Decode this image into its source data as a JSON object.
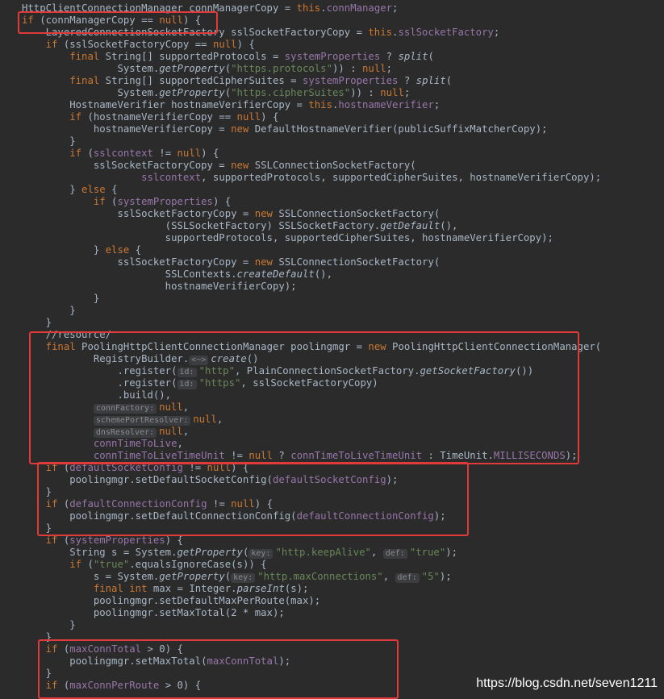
{
  "code_lines": [
    [
      [
        "HttpClientConnectionManager connManagerCopy = ",
        "p"
      ],
      [
        "this",
        "kw"
      ],
      [
        ".",
        "p"
      ],
      [
        "connManager",
        "fld"
      ],
      [
        ";",
        "p"
      ]
    ],
    [
      [
        "if",
        "kw"
      ],
      [
        " (",
        "p"
      ],
      [
        "connManagerCopy",
        "p"
      ],
      [
        " == ",
        "p"
      ],
      [
        "null",
        "kw"
      ],
      [
        ") {",
        "p"
      ]
    ],
    [
      [
        "    LayeredConnectionSocketFactory sslSocketFactoryCopy = ",
        "p"
      ],
      [
        "this",
        "kw"
      ],
      [
        ".",
        "p"
      ],
      [
        "sslSocketFactory",
        "fld"
      ],
      [
        ";",
        "p"
      ]
    ],
    [
      [
        "    ",
        "p"
      ],
      [
        "if",
        "kw"
      ],
      [
        " (sslSocketFactoryCopy == ",
        "p"
      ],
      [
        "null",
        "kw"
      ],
      [
        ") {",
        "p"
      ]
    ],
    [
      [
        "        ",
        "p"
      ],
      [
        "final",
        "kw"
      ],
      [
        " String[] supportedProtocols = ",
        "p"
      ],
      [
        "systemProperties",
        "fld"
      ],
      [
        " ? ",
        "p"
      ],
      [
        "split",
        "ital"
      ],
      [
        "(",
        "p"
      ]
    ],
    [
      [
        "                System.",
        "p"
      ],
      [
        "getProperty",
        "ital"
      ],
      [
        "(",
        "p"
      ],
      [
        "\"https.protocols\"",
        "str"
      ],
      [
        ")) : ",
        "p"
      ],
      [
        "null",
        "kw"
      ],
      [
        ";",
        "p"
      ]
    ],
    [
      [
        "        ",
        "p"
      ],
      [
        "final",
        "kw"
      ],
      [
        " String[] supportedCipherSuites = ",
        "p"
      ],
      [
        "systemProperties",
        "fld"
      ],
      [
        " ? ",
        "p"
      ],
      [
        "split",
        "ital"
      ],
      [
        "(",
        "p"
      ]
    ],
    [
      [
        "                System.",
        "p"
      ],
      [
        "getProperty",
        "ital"
      ],
      [
        "(",
        "p"
      ],
      [
        "\"https.cipherSuites\"",
        "str"
      ],
      [
        ")) : ",
        "p"
      ],
      [
        "null",
        "kw"
      ],
      [
        ";",
        "p"
      ]
    ],
    [
      [
        "        HostnameVerifier hostnameVerifierCopy = ",
        "p"
      ],
      [
        "this",
        "kw"
      ],
      [
        ".",
        "p"
      ],
      [
        "hostnameVerifier",
        "fld"
      ],
      [
        ";",
        "p"
      ]
    ],
    [
      [
        "        ",
        "p"
      ],
      [
        "if",
        "kw"
      ],
      [
        " (hostnameVerifierCopy == ",
        "p"
      ],
      [
        "null",
        "kw"
      ],
      [
        ") {",
        "p"
      ]
    ],
    [
      [
        "            hostnameVerifierCopy = ",
        "p"
      ],
      [
        "new",
        "kw"
      ],
      [
        " DefaultHostnameVerifier(publicSuffixMatcherCopy);",
        "p"
      ]
    ],
    [
      [
        "        }",
        "p"
      ]
    ],
    [
      [
        "        ",
        "p"
      ],
      [
        "if",
        "kw"
      ],
      [
        " (",
        "p"
      ],
      [
        "sslcontext",
        "fld"
      ],
      [
        " != ",
        "p"
      ],
      [
        "null",
        "kw"
      ],
      [
        ") {",
        "p"
      ]
    ],
    [
      [
        "            sslSocketFactoryCopy = ",
        "p"
      ],
      [
        "new",
        "kw"
      ],
      [
        " SSLConnectionSocketFactory(",
        "p"
      ]
    ],
    [
      [
        "                    ",
        "p"
      ],
      [
        "sslcontext",
        "fld"
      ],
      [
        ", supportedProtocols, supportedCipherSuites, hostnameVerifierCopy);",
        "p"
      ]
    ],
    [
      [
        "        } ",
        "p"
      ],
      [
        "else",
        "kw"
      ],
      [
        " {",
        "p"
      ]
    ],
    [
      [
        "            ",
        "p"
      ],
      [
        "if",
        "kw"
      ],
      [
        " (",
        "p"
      ],
      [
        "systemProperties",
        "fld"
      ],
      [
        ") {",
        "p"
      ]
    ],
    [
      [
        "                sslSocketFactoryCopy = ",
        "p"
      ],
      [
        "new",
        "kw"
      ],
      [
        " SSLConnectionSocketFactory(",
        "p"
      ]
    ],
    [
      [
        "                        (SSLSocketFactory) SSLSocketFactory.",
        "p"
      ],
      [
        "getDefault",
        "ital"
      ],
      [
        "(),",
        "p"
      ]
    ],
    [
      [
        "                        supportedProtocols, supportedCipherSuites, hostnameVerifierCopy);",
        "p"
      ]
    ],
    [
      [
        "            } ",
        "p"
      ],
      [
        "else",
        "kw"
      ],
      [
        " {",
        "p"
      ]
    ],
    [
      [
        "                sslSocketFactoryCopy = ",
        "p"
      ],
      [
        "new",
        "kw"
      ],
      [
        " SSLConnectionSocketFactory(",
        "p"
      ]
    ],
    [
      [
        "                        SSLContexts.",
        "p"
      ],
      [
        "createDefault",
        "ital"
      ],
      [
        "(),",
        "p"
      ]
    ],
    [
      [
        "                        hostnameVerifierCopy);",
        "p"
      ]
    ],
    [
      [
        "            }",
        "p"
      ]
    ],
    [
      [
        "        }",
        "p"
      ]
    ],
    [
      [
        "    }",
        "p"
      ]
    ],
    [
      [
        "    //resource/",
        "p"
      ]
    ],
    [
      [
        "    ",
        "p"
      ],
      [
        "final",
        "kw"
      ],
      [
        " PoolingHttpClientConnectionManager poolingmgr = ",
        "p"
      ],
      [
        "new",
        "kw"
      ],
      [
        " PoolingHttpClientConnectionManager(",
        "p"
      ]
    ],
    [
      [
        "            RegistryBuilder.",
        "p"
      ],
      [
        "<~>",
        "hint"
      ],
      [
        "create",
        "ital"
      ],
      [
        "()",
        "p"
      ]
    ],
    [
      [
        "                .register(",
        "p"
      ],
      [
        "id:",
        "hint"
      ],
      [
        "\"http\"",
        "str"
      ],
      [
        ", PlainConnectionSocketFactory.",
        "p"
      ],
      [
        "getSocketFactory",
        "ital"
      ],
      [
        "())",
        "p"
      ]
    ],
    [
      [
        "                .register(",
        "p"
      ],
      [
        "id:",
        "hint"
      ],
      [
        "\"https\"",
        "str"
      ],
      [
        ", sslSocketFactoryCopy)",
        "p"
      ]
    ],
    [
      [
        "                .build(),",
        "p"
      ]
    ],
    [
      [
        "            ",
        "p"
      ],
      [
        "connFactory:",
        "hint"
      ],
      [
        "null",
        "kw"
      ],
      [
        ",",
        "p"
      ]
    ],
    [
      [
        "            ",
        "p"
      ],
      [
        "schemePortResolver:",
        "hint"
      ],
      [
        "null",
        "kw"
      ],
      [
        ",",
        "p"
      ]
    ],
    [
      [
        "            ",
        "p"
      ],
      [
        "dnsResolver:",
        "hint"
      ],
      [
        "null",
        "kw"
      ],
      [
        ",",
        "p"
      ]
    ],
    [
      [
        "            ",
        "p"
      ],
      [
        "connTimeToLive",
        "fld"
      ],
      [
        ",",
        "p"
      ]
    ],
    [
      [
        "            ",
        "p"
      ],
      [
        "connTimeToLiveTimeUnit",
        "fld"
      ],
      [
        " != ",
        "p"
      ],
      [
        "null",
        "kw"
      ],
      [
        " ? ",
        "p"
      ],
      [
        "connTimeToLiveTimeUnit",
        "fld"
      ],
      [
        " : TimeUnit.",
        "p"
      ],
      [
        "MILLISECONDS",
        "fld"
      ],
      [
        ");",
        "p"
      ]
    ],
    [
      [
        "    ",
        "p"
      ],
      [
        "if",
        "kw"
      ],
      [
        " (",
        "p"
      ],
      [
        "defaultSocketConfig",
        "fld"
      ],
      [
        " != ",
        "p"
      ],
      [
        "null",
        "kw"
      ],
      [
        ") {",
        "p"
      ]
    ],
    [
      [
        "        poolingmgr.setDefaultSocketConfig(",
        "p"
      ],
      [
        "defaultSocketConfig",
        "fld"
      ],
      [
        ");",
        "p"
      ]
    ],
    [
      [
        "    }",
        "p"
      ]
    ],
    [
      [
        "    ",
        "p"
      ],
      [
        "if",
        "kw"
      ],
      [
        " (",
        "p"
      ],
      [
        "defaultConnectionConfig",
        "fld"
      ],
      [
        " != ",
        "p"
      ],
      [
        "null",
        "kw"
      ],
      [
        ") {",
        "p"
      ]
    ],
    [
      [
        "        poolingmgr.setDefaultConnectionConfig(",
        "p"
      ],
      [
        "defaultConnectionConfig",
        "fld"
      ],
      [
        ");",
        "p"
      ]
    ],
    [
      [
        "    }",
        "p"
      ]
    ],
    [
      [
        "    ",
        "p"
      ],
      [
        "if",
        "kw"
      ],
      [
        " (",
        "p"
      ],
      [
        "systemProperties",
        "fld"
      ],
      [
        ") {",
        "p"
      ]
    ],
    [
      [
        "        String s = System.",
        "p"
      ],
      [
        "getProperty",
        "ital"
      ],
      [
        "(",
        "p"
      ],
      [
        "key:",
        "hint"
      ],
      [
        "\"http.keepAlive\"",
        "str"
      ],
      [
        ", ",
        "p"
      ],
      [
        "def:",
        "hint"
      ],
      [
        "\"true\"",
        "str"
      ],
      [
        ");",
        "p"
      ]
    ],
    [
      [
        "        ",
        "p"
      ],
      [
        "if",
        "kw"
      ],
      [
        " (",
        "p"
      ],
      [
        "\"true\"",
        "str"
      ],
      [
        ".equalsIgnoreCase(s)) {",
        "p"
      ]
    ],
    [
      [
        "            s = System.",
        "p"
      ],
      [
        "getProperty",
        "ital"
      ],
      [
        "(",
        "p"
      ],
      [
        "key:",
        "hint"
      ],
      [
        "\"http.maxConnections\"",
        "str"
      ],
      [
        ", ",
        "p"
      ],
      [
        "def:",
        "hint"
      ],
      [
        "\"5\"",
        "str"
      ],
      [
        ");",
        "p"
      ]
    ],
    [
      [
        "            ",
        "p"
      ],
      [
        "final",
        "kw"
      ],
      [
        " ",
        "p"
      ],
      [
        "int",
        "kw"
      ],
      [
        " max = Integer.",
        "p"
      ],
      [
        "parseInt",
        "ital"
      ],
      [
        "(s);",
        "p"
      ]
    ],
    [
      [
        "            poolingmgr.setDefaultMaxPerRoute(max);",
        "p"
      ]
    ],
    [
      [
        "            poolingmgr.setMaxTotal(2 * max);",
        "p"
      ]
    ],
    [
      [
        "        }",
        "p"
      ]
    ],
    [
      [
        "    }",
        "p"
      ]
    ],
    [
      [
        "    ",
        "p"
      ],
      [
        "if",
        "kw"
      ],
      [
        " (",
        "p"
      ],
      [
        "maxConnTotal",
        "fld"
      ],
      [
        " > 0) {",
        "p"
      ]
    ],
    [
      [
        "        poolingmgr.setMaxTotal(",
        "p"
      ],
      [
        "maxConnTotal",
        "fld"
      ],
      [
        ");",
        "p"
      ]
    ],
    [
      [
        "    }",
        "p"
      ]
    ],
    [
      [
        "    ",
        "p"
      ],
      [
        "if",
        "kw"
      ],
      [
        " (",
        "p"
      ],
      [
        "maxConnPerRoute",
        "fld"
      ],
      [
        " > 0) {",
        "p"
      ]
    ]
  ],
  "watermark": "https://blog.csdn.net/seven1211",
  "colors": {
    "background": "#2b2b2b",
    "plain": "#a9b7c6",
    "keyword": "#cc7832",
    "field": "#9876aa",
    "string": "#6a8759",
    "highlight_box": "#e03a3a"
  }
}
